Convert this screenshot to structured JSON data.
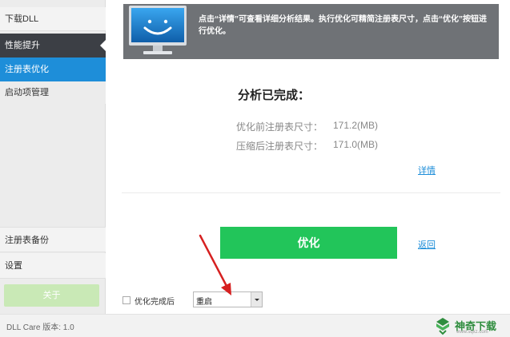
{
  "sidebar": {
    "top_item": "下载DLL",
    "section": "性能提升",
    "active_item": "注册表优化",
    "sub_item": "启动项管理",
    "bottom_items": [
      "注册表备份",
      "设置"
    ],
    "about_button": "关于"
  },
  "banner": {
    "message": "点击“详情”可查看详细分析结果。执行优化可精简注册表尺寸，点击“优化”按钮进行优化。",
    "icon": "smiley-monitor-icon"
  },
  "result": {
    "title": "分析已完成：",
    "before_label": "优化前注册表尺寸：",
    "before_value": "171.2(MB)",
    "after_label": "压缩后注册表尺寸：",
    "after_value": "171.0(MB)",
    "details_link": "详情"
  },
  "actions": {
    "optimize_button": "优化",
    "back_link": "返回"
  },
  "options": {
    "checkbox_label": "优化完成后",
    "select_value": "重启"
  },
  "footer": {
    "version": "DLL Care 版本: 1.0",
    "watermark_text": "神奇下载",
    "watermark_url": "www.sqxz.com"
  },
  "colors": {
    "accent_blue": "#1e8ed9",
    "optimize_green": "#22c55a",
    "sidebar_dark": "#3c3f45",
    "banner_gray": "#6f7276"
  }
}
